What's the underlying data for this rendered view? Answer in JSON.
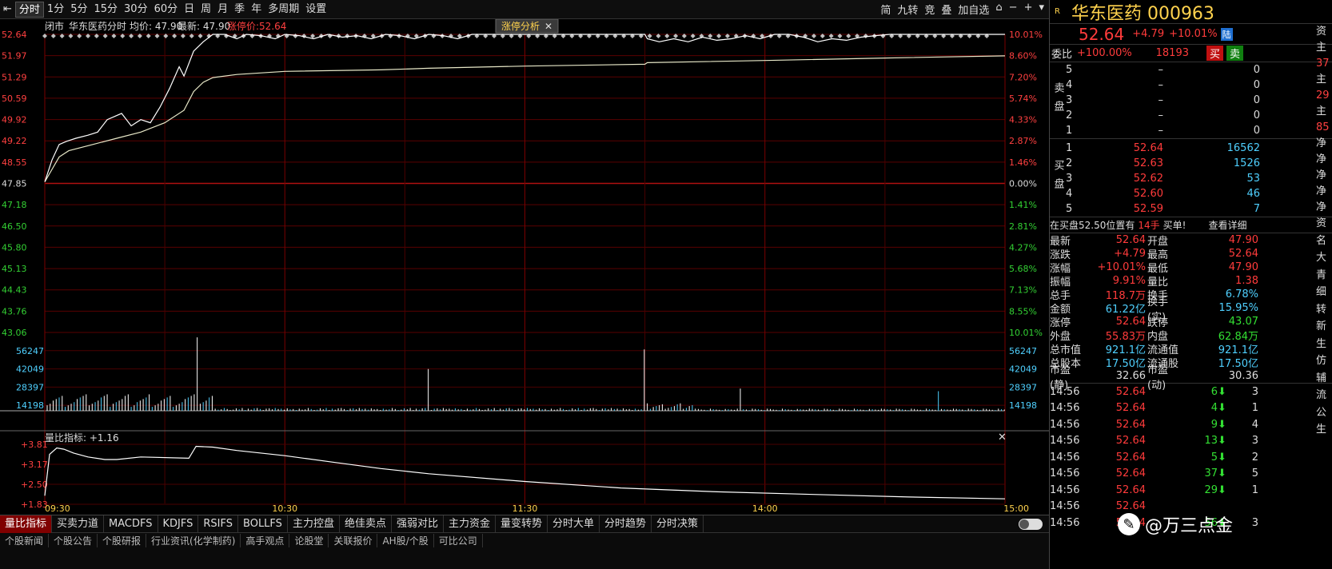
{
  "toolbar": {
    "periods": [
      "分时",
      "1分",
      "5分",
      "15分",
      "30分",
      "60分",
      "日",
      "周",
      "月",
      "季",
      "年",
      "多周期",
      "设置"
    ],
    "active": "分时",
    "right_items": [
      "简",
      "九转",
      "竞",
      "叠",
      "加自选"
    ]
  },
  "header": {
    "status": "闭市",
    "name": "华东医药",
    "period_label": "分时",
    "avg_label": "均价: 47.90",
    "latest_label": "最新: 47.90",
    "limit_label": "涨停价:52.64",
    "analysis_button": "涨停分析"
  },
  "price_axis": {
    "left": [
      "52.64",
      "51.97",
      "51.29",
      "50.59",
      "49.92",
      "49.22",
      "48.55",
      "47.85",
      "47.18",
      "46.50",
      "45.80",
      "45.13",
      "44.43",
      "43.76",
      "43.06"
    ],
    "right": [
      "10.01%",
      "8.60%",
      "7.20%",
      "5.74%",
      "4.33%",
      "2.87%",
      "1.46%",
      "0.00%",
      "1.41%",
      "2.81%",
      "4.27%",
      "5.68%",
      "7.13%",
      "8.55%",
      "10.01%"
    ]
  },
  "volume_axis": [
    "56247",
    "42049",
    "28397",
    "14198"
  ],
  "ratio_panel": {
    "label": "量比指标: +1.16",
    "axis": [
      "+3.81",
      "+3.17",
      "+2.50",
      "+1.83"
    ]
  },
  "time_axis": [
    "09:30",
    "10:30",
    "11:30",
    "14:00",
    "15:00"
  ],
  "chart_data": {
    "type": "line",
    "title": "华东医药 分时",
    "prev_close": 47.85,
    "ylim": [
      43.06,
      52.64
    ],
    "price_series": [
      [
        0,
        47.9
      ],
      [
        3,
        48.6
      ],
      [
        6,
        49.1
      ],
      [
        9,
        49.2
      ],
      [
        13,
        49.3
      ],
      [
        18,
        49.4
      ],
      [
        22,
        49.5
      ],
      [
        26,
        49.9
      ],
      [
        32,
        50.1
      ],
      [
        36,
        49.7
      ],
      [
        40,
        49.9
      ],
      [
        44,
        49.8
      ],
      [
        48,
        50.3
      ],
      [
        52,
        50.9
      ],
      [
        56,
        51.6
      ],
      [
        58,
        51.3
      ],
      [
        62,
        52.1
      ],
      [
        66,
        52.4
      ],
      [
        70,
        52.64
      ],
      [
        75,
        52.64
      ],
      [
        80,
        52.5
      ],
      [
        84,
        52.64
      ],
      [
        90,
        52.6
      ],
      [
        96,
        52.5
      ],
      [
        100,
        52.64
      ],
      [
        106,
        52.6
      ],
      [
        112,
        52.5
      ],
      [
        118,
        52.64
      ],
      [
        124,
        52.55
      ],
      [
        130,
        52.6
      ],
      [
        136,
        52.5
      ],
      [
        142,
        52.64
      ],
      [
        148,
        52.6
      ],
      [
        154,
        52.5
      ],
      [
        160,
        52.64
      ],
      [
        166,
        52.6
      ],
      [
        172,
        52.5
      ],
      [
        178,
        52.64
      ],
      [
        184,
        52.64
      ],
      [
        190,
        52.64
      ],
      [
        196,
        52.64
      ],
      [
        202,
        52.64
      ],
      [
        208,
        52.64
      ],
      [
        214,
        52.64
      ],
      [
        220,
        52.64
      ],
      [
        226,
        52.64
      ],
      [
        232,
        52.64
      ],
      [
        238,
        52.64
      ],
      [
        244,
        52.64
      ],
      [
        250,
        52.64
      ],
      [
        251,
        52.5
      ],
      [
        256,
        52.4
      ],
      [
        262,
        52.5
      ],
      [
        268,
        52.4
      ],
      [
        274,
        52.55
      ],
      [
        280,
        52.45
      ],
      [
        286,
        52.5
      ],
      [
        292,
        52.6
      ],
      [
        298,
        52.5
      ],
      [
        304,
        52.64
      ],
      [
        310,
        52.64
      ],
      [
        316,
        52.55
      ],
      [
        322,
        52.4
      ],
      [
        328,
        52.5
      ],
      [
        334,
        52.45
      ],
      [
        340,
        52.55
      ],
      [
        346,
        52.6
      ],
      [
        352,
        52.64
      ],
      [
        358,
        52.64
      ],
      [
        364,
        52.64
      ],
      [
        370,
        52.64
      ],
      [
        376,
        52.64
      ],
      [
        382,
        52.64
      ],
      [
        388,
        52.64
      ],
      [
        394,
        52.64
      ],
      [
        400,
        52.64
      ]
    ],
    "avg_series": [
      [
        0,
        47.9
      ],
      [
        3,
        48.3
      ],
      [
        6,
        48.7
      ],
      [
        10,
        48.9
      ],
      [
        20,
        49.1
      ],
      [
        30,
        49.3
      ],
      [
        40,
        49.5
      ],
      [
        50,
        49.8
      ],
      [
        58,
        50.2
      ],
      [
        62,
        50.8
      ],
      [
        66,
        51.1
      ],
      [
        70,
        51.25
      ],
      [
        80,
        51.35
      ],
      [
        100,
        51.45
      ],
      [
        140,
        51.5
      ],
      [
        160,
        51.55
      ],
      [
        200,
        51.62
      ],
      [
        250,
        51.68
      ],
      [
        251,
        51.73
      ],
      [
        300,
        51.8
      ],
      [
        350,
        51.88
      ],
      [
        400,
        51.95
      ]
    ],
    "volume_series": {
      "peaks": [
        [
          64,
          56247
        ],
        [
          160,
          32000
        ],
        [
          250,
          47000
        ],
        [
          290,
          17000
        ],
        [
          372,
          15000
        ]
      ]
    },
    "ratio_series": [
      [
        0,
        1.9
      ],
      [
        2,
        3.5
      ],
      [
        5,
        3.75
      ],
      [
        8,
        3.7
      ],
      [
        12,
        3.55
      ],
      [
        18,
        3.4
      ],
      [
        25,
        3.3
      ],
      [
        30,
        3.3
      ],
      [
        40,
        3.4
      ],
      [
        60,
        3.35
      ],
      [
        63,
        3.81
      ],
      [
        70,
        3.78
      ],
      [
        80,
        3.65
      ],
      [
        100,
        3.45
      ],
      [
        120,
        3.2
      ],
      [
        140,
        2.95
      ],
      [
        160,
        2.75
      ],
      [
        200,
        2.45
      ],
      [
        240,
        2.2
      ],
      [
        280,
        2.05
      ],
      [
        320,
        1.95
      ],
      [
        360,
        1.85
      ],
      [
        400,
        1.78
      ]
    ]
  },
  "side": {
    "r_label": "R",
    "stock_title": "华东医药 000963",
    "price": "52.64",
    "change": "+4.79",
    "change_pct": "+10.01%",
    "badge": "陆",
    "weibi_label": "委比",
    "weibi_value": "+100.00%",
    "weibi_diff": "18193",
    "buy_btn": "买",
    "sell_btn": "卖",
    "sell_label": "卖盘",
    "buy_label": "买盘",
    "sells": [
      {
        "lvl": "5",
        "price": "–",
        "vol": "0"
      },
      {
        "lvl": "4",
        "price": "–",
        "vol": "0"
      },
      {
        "lvl": "3",
        "price": "–",
        "vol": "0"
      },
      {
        "lvl": "2",
        "price": "–",
        "vol": "0"
      },
      {
        "lvl": "1",
        "price": "–",
        "vol": "0"
      }
    ],
    "buys": [
      {
        "lvl": "1",
        "price": "52.64",
        "vol": "16562"
      },
      {
        "lvl": "2",
        "price": "52.63",
        "vol": "1526"
      },
      {
        "lvl": "3",
        "price": "52.62",
        "vol": "53"
      },
      {
        "lvl": "4",
        "price": "52.60",
        "vol": "46"
      },
      {
        "lvl": "5",
        "price": "52.59",
        "vol": "7"
      }
    ],
    "notice_prefix": "在买盘52.50位置有",
    "notice_hand": "14手",
    "notice_suffix": "买单!",
    "detail_link": "查看详细",
    "stats": [
      [
        "最新",
        "52.64",
        "red",
        "开盘",
        "47.90",
        "red"
      ],
      [
        "涨跌",
        "+4.79",
        "red",
        "最高",
        "52.64",
        "red"
      ],
      [
        "涨幅",
        "+10.01%",
        "red",
        "最低",
        "47.90",
        "red"
      ],
      [
        "振幅",
        "9.91%",
        "red",
        "量比",
        "1.38",
        "red"
      ],
      [
        "总手",
        "118.7万",
        "red",
        "换手",
        "6.78%",
        "cyan"
      ],
      [
        "金额",
        "61.22亿",
        "cyan",
        "换手(实)",
        "15.95%",
        "cyan"
      ],
      [
        "涨停",
        "52.64",
        "red",
        "跌停",
        "43.07",
        "green"
      ],
      [
        "外盘",
        "55.83万",
        "red",
        "内盘",
        "62.84万",
        "green"
      ],
      [
        "总市值",
        "921.1亿",
        "cyan",
        "流通值",
        "921.1亿",
        "cyan"
      ],
      [
        "总股本",
        "17.50亿",
        "cyan",
        "流通股",
        "17.50亿",
        "cyan"
      ],
      [
        "市盈(静)",
        "32.66",
        "white",
        "市盈(动)",
        "30.36",
        "white"
      ]
    ],
    "ticks": [
      {
        "time": "14:56",
        "price": "52.64",
        "vol": "6",
        "n": "3"
      },
      {
        "time": "14:56",
        "price": "52.64",
        "vol": "4",
        "n": "1"
      },
      {
        "time": "14:56",
        "price": "52.64",
        "vol": "9",
        "n": "4"
      },
      {
        "time": "14:56",
        "price": "52.64",
        "vol": "13",
        "n": "3"
      },
      {
        "time": "14:56",
        "price": "52.64",
        "vol": "5",
        "n": "2"
      },
      {
        "time": "14:56",
        "price": "52.64",
        "vol": "37",
        "n": "5"
      },
      {
        "time": "14:56",
        "price": "52.64",
        "vol": "29",
        "n": "1"
      },
      {
        "time": "14:56",
        "price": "52.64",
        "vol": "",
        "n": ""
      },
      {
        "time": "14:56",
        "price": "52.64",
        "vol": "56",
        "n": "3"
      }
    ],
    "edge_col": [
      "资",
      "主",
      "37",
      "主",
      "29",
      "主",
      "85",
      "净",
      "净",
      "净",
      "净",
      "净",
      "资",
      "名",
      "大",
      "青",
      "细",
      "转",
      "新",
      "生",
      "仿",
      "辅",
      "流",
      "公",
      "生"
    ]
  },
  "bottom_tabs": [
    "量比指标",
    "买卖力道",
    "MACDFS",
    "KDJFS",
    "RSIFS",
    "BOLLFS",
    "主力控盘",
    "绝佳卖点",
    "强弱对比",
    "主力资金",
    "量变转势",
    "分时大单",
    "分时趋势",
    "分时决策"
  ],
  "bottom_tabs_active": "量比指标",
  "bottom_tabs2": [
    "个股新闻",
    "个股公告",
    "个股研报",
    "行业资讯(化学制药)",
    "高手观点",
    "论股堂",
    "关联报价",
    "AH股/个股",
    "可比公司"
  ],
  "watermark": "@万三点金"
}
